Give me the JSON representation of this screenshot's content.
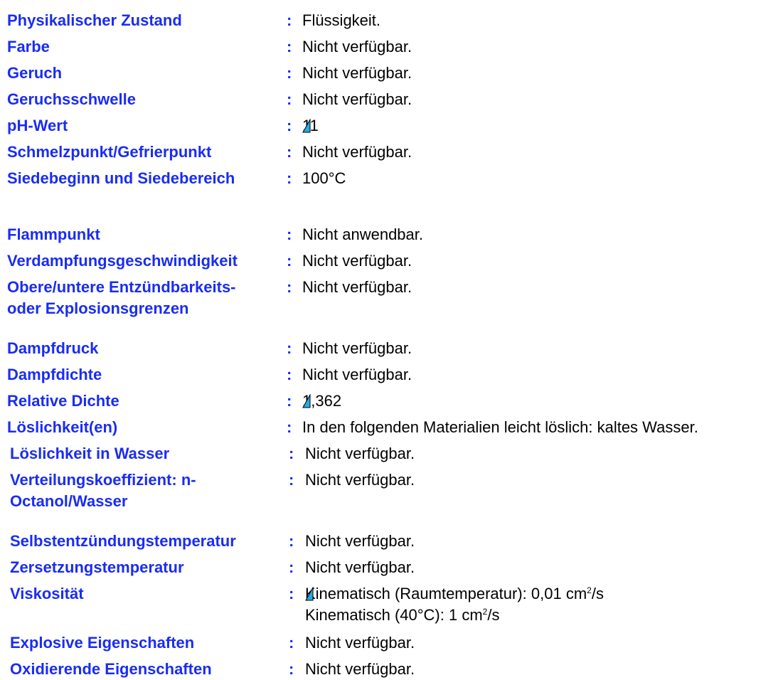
{
  "rows": [
    {
      "label": "Physikalischer Zustand",
      "value": "Flüssigkeit."
    },
    {
      "label": "Farbe",
      "value": "Nicht verfügbar."
    },
    {
      "label": "Geruch",
      "value": "Nicht verfügbar."
    },
    {
      "label": "Geruchsschwelle",
      "value": "Nicht verfügbar."
    },
    {
      "label": "pH-Wert",
      "value": "11"
    },
    {
      "label": "Schmelzpunkt/Gefrierpunkt",
      "value": "Nicht verfügbar."
    },
    {
      "label": "Siedebeginn und Siedebereich",
      "value": "100°C"
    },
    {
      "label": "Flammpunkt",
      "value": "Nicht anwendbar."
    },
    {
      "label": "Verdampfungsgeschwindigkeit",
      "value": "Nicht verfügbar."
    },
    {
      "label_line1": "Obere/untere Entzündbarkeits-",
      "label_line2": "oder Explosionsgrenzen",
      "value": "Nicht verfügbar."
    },
    {
      "label": "Dampfdruck",
      "value": "Nicht verfügbar."
    },
    {
      "label": "Dampfdichte",
      "value": "Nicht verfügbar."
    },
    {
      "label": "Relative Dichte",
      "value": "1,362"
    },
    {
      "label": "Löslichkeit(en)",
      "value": "In den folgenden Materialien leicht löslich: kaltes Wasser."
    },
    {
      "label": "Löslichkeit in Wasser",
      "value": "Nicht verfügbar."
    },
    {
      "label_line1": "Verteilungskoeffizient: n-",
      "label_line2": "Octanol/Wasser",
      "value": "Nicht verfügbar."
    },
    {
      "label": "Selbstentzündungstemperatur",
      "value": "Nicht verfügbar."
    },
    {
      "label": "Zersetzungstemperatur",
      "value": "Nicht verfügbar."
    },
    {
      "label": "Viskosität",
      "value_line1_prefix": "Kinematisch (Raumtemperatur): 0,01 cm",
      "value_line1_sup": "2",
      "value_line1_suffix": "/s",
      "value_line2_prefix": "Kinematisch (40°C): 1 cm",
      "value_line2_sup": "2",
      "value_line2_suffix": "/s"
    },
    {
      "label": "Explosive Eigenschaften",
      "value": "Nicht verfügbar."
    },
    {
      "label": "Oxidierende Eigenschaften",
      "value": "Nicht verfügbar."
    }
  ],
  "colon": ":",
  "colors": {
    "label": "#1a2cf4",
    "marker": "#29a9e0"
  }
}
